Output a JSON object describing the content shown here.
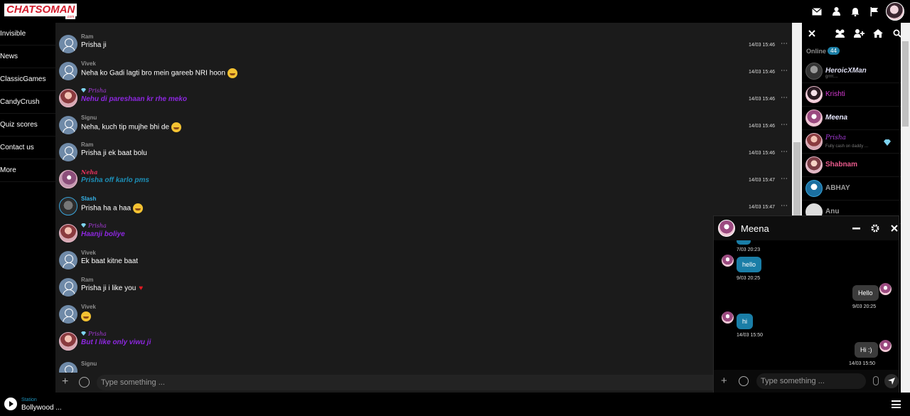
{
  "header": {
    "logo_text": "CHATSOMAN",
    "logo_domain": ".com",
    "icons": [
      "envelope-icon",
      "user-icon",
      "bell-icon",
      "flag-icon"
    ]
  },
  "leftnav": {
    "items": [
      {
        "label": "Invisible"
      },
      {
        "label": "News"
      },
      {
        "label": "ClassicGames"
      },
      {
        "label": "CandyCrush"
      },
      {
        "label": "Quiz scores"
      },
      {
        "label": "Contact us"
      },
      {
        "label": "More"
      }
    ]
  },
  "messages": [
    {
      "name": "Ram",
      "text": "Prisha ji",
      "time": "14/03 15:46",
      "style": "user"
    },
    {
      "name": "Vivek",
      "text": "Neha ko Gadi lagti bro mein gareeb NRI hoon",
      "time": "14/03 15:46",
      "style": "user",
      "emoji": "tongue"
    },
    {
      "name": "Prisha",
      "text": "Nehu di pareshaan kr rhe meko",
      "time": "14/03 15:46",
      "style": "prisha"
    },
    {
      "name": "Signu",
      "text": "Neha, kuch tip mujhe bhi de",
      "time": "14/03 15:46",
      "style": "user",
      "emoji": "think"
    },
    {
      "name": "Ram",
      "text": "Prisha ji ek baat bolu",
      "time": "14/03 15:46",
      "style": "user"
    },
    {
      "name": "Neha",
      "text": "Prisha off karlo pms",
      "time": "14/03 15:47",
      "style": "neha"
    },
    {
      "name": "Slash",
      "text": "Prisha ha a haa",
      "time": "14/03 15:47",
      "style": "slash",
      "emoji": "grin"
    },
    {
      "name": "Prisha",
      "text": "Haanji boliye",
      "time": "",
      "style": "prisha"
    },
    {
      "name": "Vivek",
      "text": "Ek baat kitne baat",
      "time": "",
      "style": "user"
    },
    {
      "name": "Ram",
      "text": "Prisha ji i like you",
      "time": "",
      "style": "user",
      "heart": true
    },
    {
      "name": "Vivek",
      "text": "",
      "time": "",
      "style": "user",
      "emoji": "hearteyes"
    },
    {
      "name": "Prisha",
      "text": "But I like only viwu ji",
      "time": "",
      "style": "prisha"
    },
    {
      "name": "Signu",
      "text": "",
      "time": "",
      "style": "user"
    }
  ],
  "main_input": {
    "placeholder": "Type something ..."
  },
  "rightpanel": {
    "online_label": "Online",
    "online_count": "44",
    "users": [
      {
        "name": "HeroicXMan",
        "sub": "grrrr....",
        "color": "#dcdcf0"
      },
      {
        "name": "Krishti",
        "sub": "",
        "color": "#d43ad0"
      },
      {
        "name": "Meena",
        "sub": "",
        "color": "#e8e8ff"
      },
      {
        "name": "Prisha",
        "sub": "Fully cash on daddy ...",
        "color": "#a43ad6"
      },
      {
        "name": "Shabnam",
        "sub": "",
        "color": "#ea5a8c"
      },
      {
        "name": "ABHAY",
        "sub": "",
        "color": "#9a9a9a"
      },
      {
        "name": "Anu",
        "sub": "",
        "color": "#9a9a9a"
      }
    ]
  },
  "private_chat": {
    "title": "Meena",
    "messages": [
      {
        "dir": "in",
        "text": "",
        "time": "7/03 20:23"
      },
      {
        "dir": "in",
        "text": "hello",
        "time": "9/03 20:25"
      },
      {
        "dir": "out",
        "text": "Hello",
        "time": "9/03 20:25"
      },
      {
        "dir": "in",
        "text": "hi",
        "time": "14/03 15:50"
      },
      {
        "dir": "out",
        "text": "Hi :)",
        "time": "14/03 15:50"
      }
    ],
    "input_placeholder": "Type something ..."
  },
  "footer": {
    "station_label": "Station",
    "station_name": "Bollywood ..."
  },
  "colors": {
    "accent": "#1a7ea7",
    "prisha": "#8d27e0",
    "neha": "#e4315b"
  }
}
